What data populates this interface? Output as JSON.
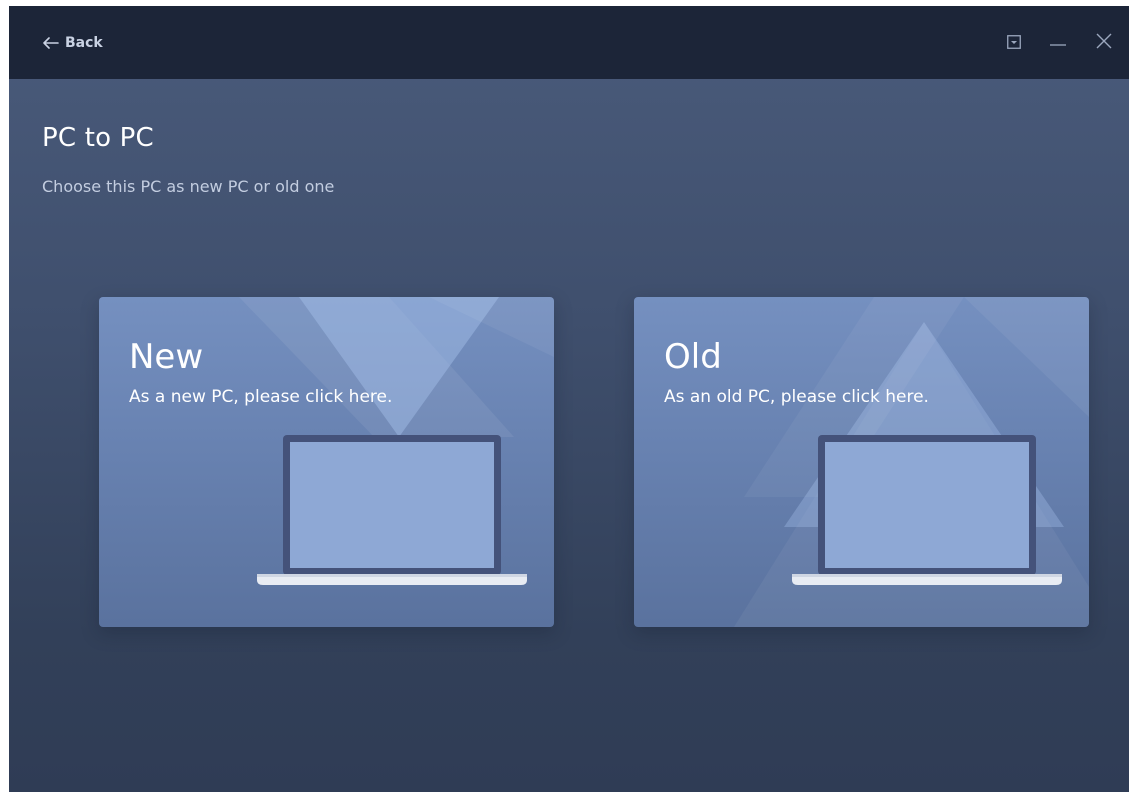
{
  "header": {
    "back_label": "Back",
    "back_icon": "arrow-left-icon",
    "controls": [
      {
        "icon": "dropdown-menu-icon"
      },
      {
        "icon": "minimize-icon"
      },
      {
        "icon": "close-icon"
      }
    ]
  },
  "main": {
    "title": "PC to PC",
    "subtitle": "Choose this PC as new PC or old one"
  },
  "cards": [
    {
      "heading": "New",
      "description": "As a new PC, please click here.",
      "icon": "laptop-icon"
    },
    {
      "heading": "Old",
      "description": "As an old PC, please click here.",
      "icon": "laptop-icon"
    }
  ],
  "colors": {
    "topbar": "#1c2538",
    "background": "#3f4f6d",
    "card": "#6882b1",
    "laptop_frame": "#44527a",
    "laptop_screen": "#8ea8d5"
  }
}
